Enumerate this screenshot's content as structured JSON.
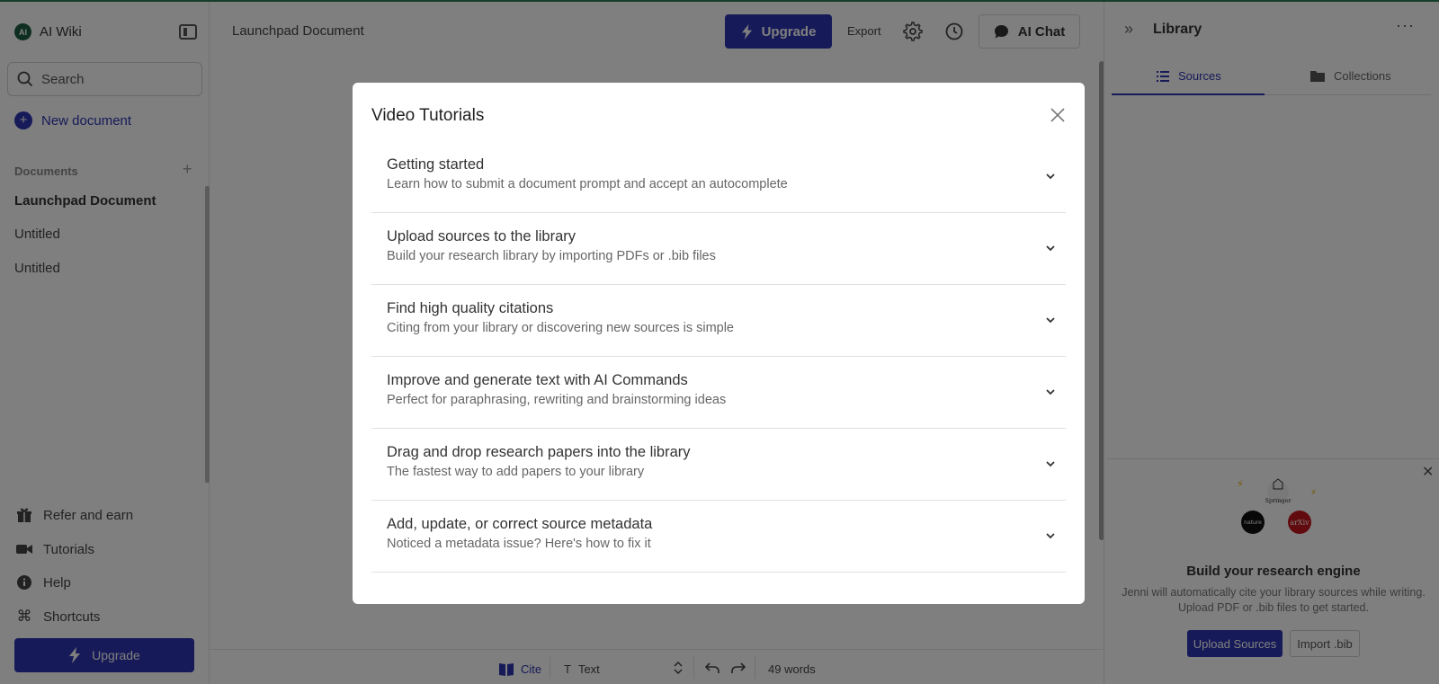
{
  "brand": {
    "logo_text": "AI",
    "name": "AI Wiki"
  },
  "search": {
    "placeholder": "Search"
  },
  "new_document_label": "New document",
  "documents": {
    "header": "Documents",
    "items": [
      {
        "label": "Launchpad Document"
      },
      {
        "label": "Untitled"
      },
      {
        "label": "Untitled"
      }
    ]
  },
  "sidebar_bottom": {
    "refer": "Refer and earn",
    "tutorials": "Tutorials",
    "help": "Help",
    "shortcuts": "Shortcuts",
    "upgrade": "Upgrade"
  },
  "topbar": {
    "doc_title": "Launchpad Document",
    "upgrade": "Upgrade",
    "export": "Export",
    "ai_chat": "AI Chat"
  },
  "library": {
    "title": "Library",
    "tabs": [
      {
        "label": "Sources"
      },
      {
        "label": "Collections"
      }
    ],
    "card": {
      "title": "Build your research engine",
      "text_line1": "Jenni will automatically cite your library sources while writing.",
      "text_line2": "Upload PDF or .bib files to get started.",
      "upload_button": "Upload Sources",
      "import_button": "Import .bib",
      "logos": [
        "Springer",
        "nature",
        "arXiv"
      ]
    }
  },
  "bottombar": {
    "cite": "Cite",
    "text_style": "Text",
    "word_count": "49 words"
  },
  "modal": {
    "title": "Video Tutorials",
    "items": [
      {
        "title": "Getting started",
        "description": "Learn how to submit a document prompt and accept an autocomplete"
      },
      {
        "title": "Upload sources to the library",
        "description": "Build your research library by importing PDFs or .bib files"
      },
      {
        "title": "Find high quality citations",
        "description": "Citing from your library or discovering new sources is simple"
      },
      {
        "title": "Improve and generate text with AI Commands",
        "description": "Perfect for paraphrasing, rewriting and brainstorming ideas"
      },
      {
        "title": "Drag and drop research papers into the library",
        "description": "The fastest way to add papers to your library"
      },
      {
        "title": "Add, update, or correct source metadata",
        "description": "Noticed a metadata issue? Here's how to fix it"
      }
    ]
  },
  "colors": {
    "accent": "#2d35b0",
    "brand": "#1d5c45"
  }
}
